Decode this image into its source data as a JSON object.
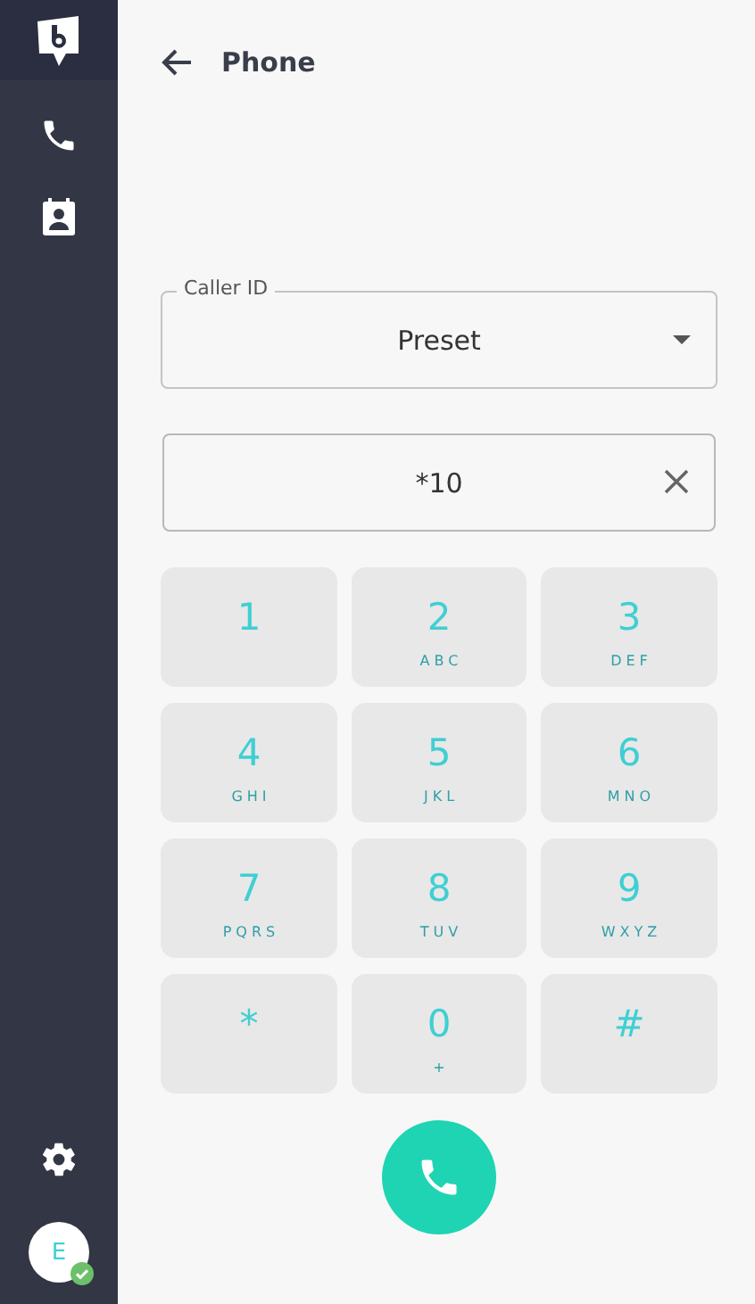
{
  "header": {
    "title": "Phone"
  },
  "caller_id": {
    "label": "Caller ID",
    "value": "Preset"
  },
  "number_field": {
    "value": "*10"
  },
  "keypad": [
    {
      "digit": "1"
    },
    {
      "digit": "2",
      "letters": "ABC"
    },
    {
      "digit": "3",
      "letters": "DEF"
    },
    {
      "digit": "4",
      "letters": "GHI"
    },
    {
      "digit": "5",
      "letters": "JKL"
    },
    {
      "digit": "6",
      "letters": "MNO"
    },
    {
      "digit": "7",
      "letters": "PQRS"
    },
    {
      "digit": "8",
      "letters": "TUV"
    },
    {
      "digit": "9",
      "letters": "WXYZ"
    },
    {
      "digit": "*"
    },
    {
      "digit": "0",
      "letters": "+"
    },
    {
      "digit": "#"
    }
  ],
  "user": {
    "initial": "E"
  }
}
